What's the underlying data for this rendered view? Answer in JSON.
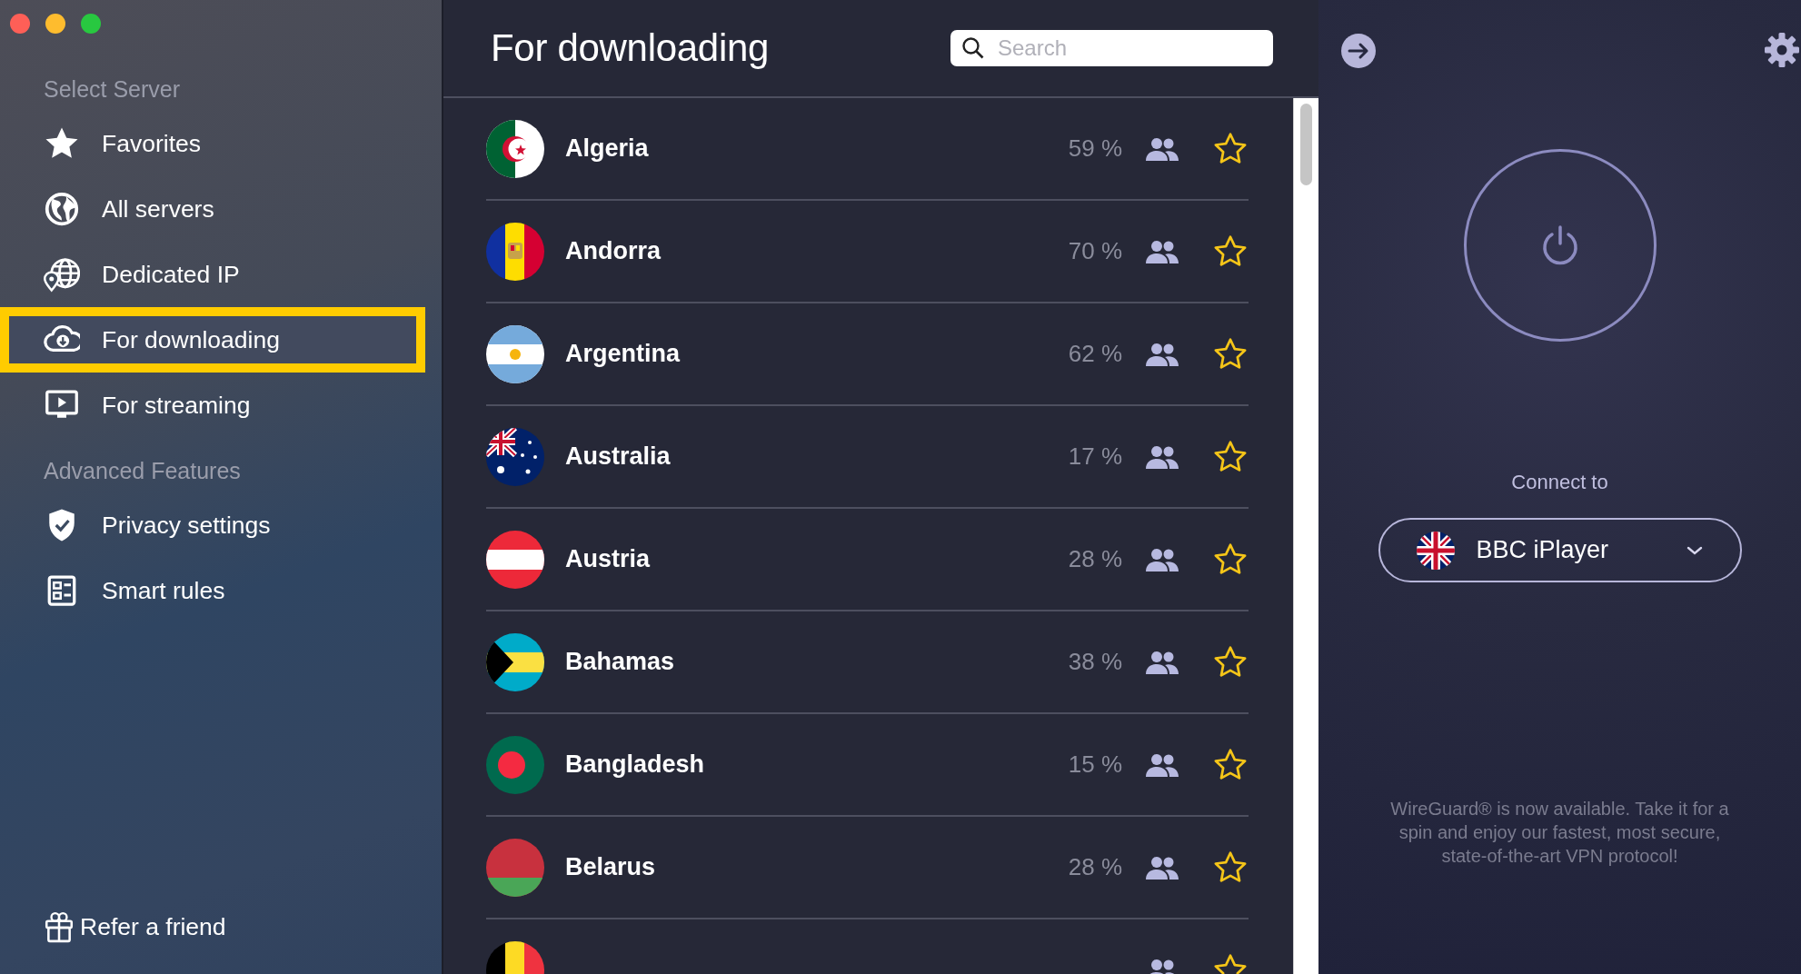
{
  "sidebar": {
    "sections": [
      {
        "title": "Select Server",
        "items": [
          {
            "label": "Favorites",
            "selected": false
          },
          {
            "label": "All servers",
            "selected": false
          },
          {
            "label": "Dedicated IP",
            "selected": false
          },
          {
            "label": "For downloading",
            "selected": true
          },
          {
            "label": "For streaming",
            "selected": false
          }
        ]
      },
      {
        "title": "Advanced Features",
        "items": [
          {
            "label": "Privacy settings",
            "selected": false
          },
          {
            "label": "Smart rules",
            "selected": false
          }
        ]
      }
    ],
    "footer_link": "Refer a friend"
  },
  "server_list": {
    "title": "For downloading",
    "search": {
      "placeholder": "Search"
    },
    "rows": [
      {
        "name": "Algeria",
        "load": "59 %",
        "favorite": false
      },
      {
        "name": "Andorra",
        "load": "70 %",
        "favorite": false
      },
      {
        "name": "Argentina",
        "load": "62 %",
        "favorite": false
      },
      {
        "name": "Australia",
        "load": "17 %",
        "favorite": false
      },
      {
        "name": "Austria",
        "load": "28 %",
        "favorite": false
      },
      {
        "name": "Bahamas",
        "load": "38 %",
        "favorite": false
      },
      {
        "name": "Bangladesh",
        "load": "15 %",
        "favorite": false
      },
      {
        "name": "Belarus",
        "load": "28 %",
        "favorite": false
      },
      {
        "favorite": false
      }
    ]
  },
  "connect_panel": {
    "label": "Connect to",
    "location": "BBC iPlayer",
    "notice": "WireGuard® is now available. Take it for a spin and enjoy our fastest, most secure, state-of-the-art VPN protocol!"
  }
}
